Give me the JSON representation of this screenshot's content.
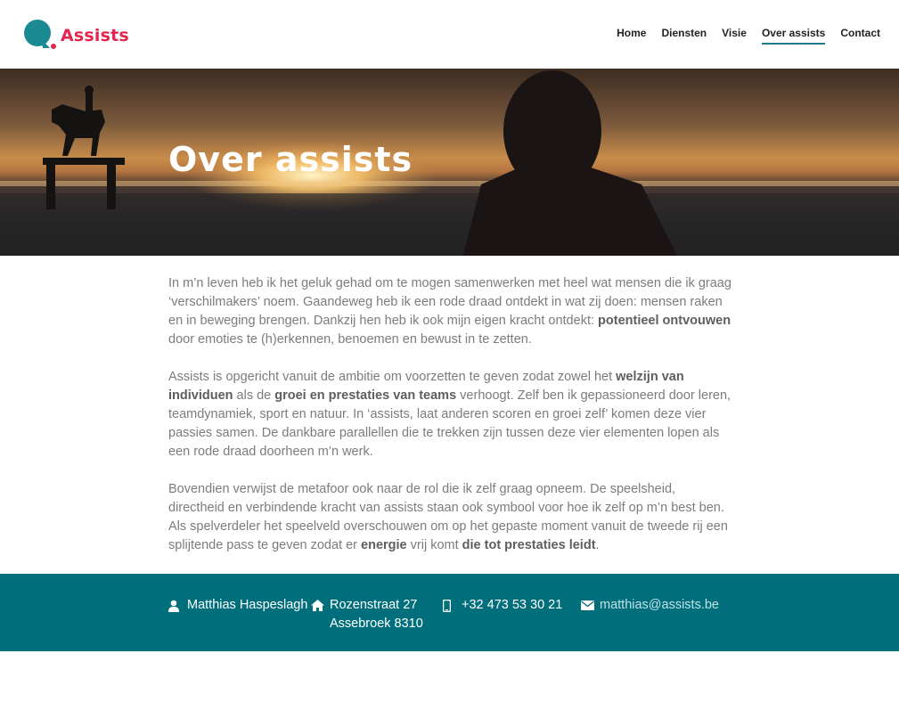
{
  "brand": {
    "name": "Assists",
    "accent": "#e2264d",
    "teal": "#1c7b8a"
  },
  "nav": {
    "items": [
      {
        "label": "Home",
        "active": false
      },
      {
        "label": "Diensten",
        "active": false
      },
      {
        "label": "Visie",
        "active": false
      },
      {
        "label": "Over assists",
        "active": true
      },
      {
        "label": "Contact",
        "active": false
      }
    ]
  },
  "hero": {
    "title": "Over assists"
  },
  "content": {
    "p1": {
      "t1": "In m’n leven heb ik het geluk gehad om te mogen samenwerken met heel wat mensen die ik graag ‘verschilmakers’ noem. Gaandeweg heb ik een rode draad ontdekt in wat zij doen: mensen raken en in beweging brengen. Dankzij hen heb ik ook mijn eigen kracht ontdekt: ",
      "b1": "potentieel ontvouwen",
      "t2": " door emoties te (h)erkennen, benoemen en bewust in te zetten."
    },
    "p2": {
      "t1": "Assists is opgericht vanuit de ambitie om voorzetten te geven zodat zowel het ",
      "b1": "welzijn van individuen",
      "t2": " als de ",
      "b2": "groei en prestaties van teams",
      "t3": " verhoogt. Zelf ben ik gepassioneerd door leren, teamdynamiek, sport en natuur. In ‘assists, laat anderen scoren en groei zelf’ komen deze vier passies samen. De dankbare parallellen die te trekken zijn tussen deze vier elementen lopen als een rode draad doorheen m’n werk."
    },
    "p3": {
      "t1": "Bovendien verwijst de metafoor ook naar de rol die ik zelf graag opneem. De speelsheid, directheid en verbindende kracht van assists staan ook symbool voor hoe ik zelf op m’n best ben. Als spelverdeler het speelveld overschouwen om op het gepaste moment vanuit de tweede rij een splijtende pass te geven zodat er ",
      "b1": "energie",
      "t2": " vrij komt ",
      "b2": "die tot prestaties leidt",
      "t3": "."
    }
  },
  "footer": {
    "name": {
      "icon": "user-icon",
      "text": "Matthias Haspeslagh"
    },
    "address": {
      "icon": "home-icon",
      "line1": "Rozenstraat 27",
      "line2": "Assebroek 8310"
    },
    "phone": {
      "icon": "mobile-phone-icon",
      "text": "+32 473 53 30 21"
    },
    "email": {
      "icon": "envelope-icon",
      "text": "matthias@assists.be"
    },
    "background": "#006f7b"
  }
}
